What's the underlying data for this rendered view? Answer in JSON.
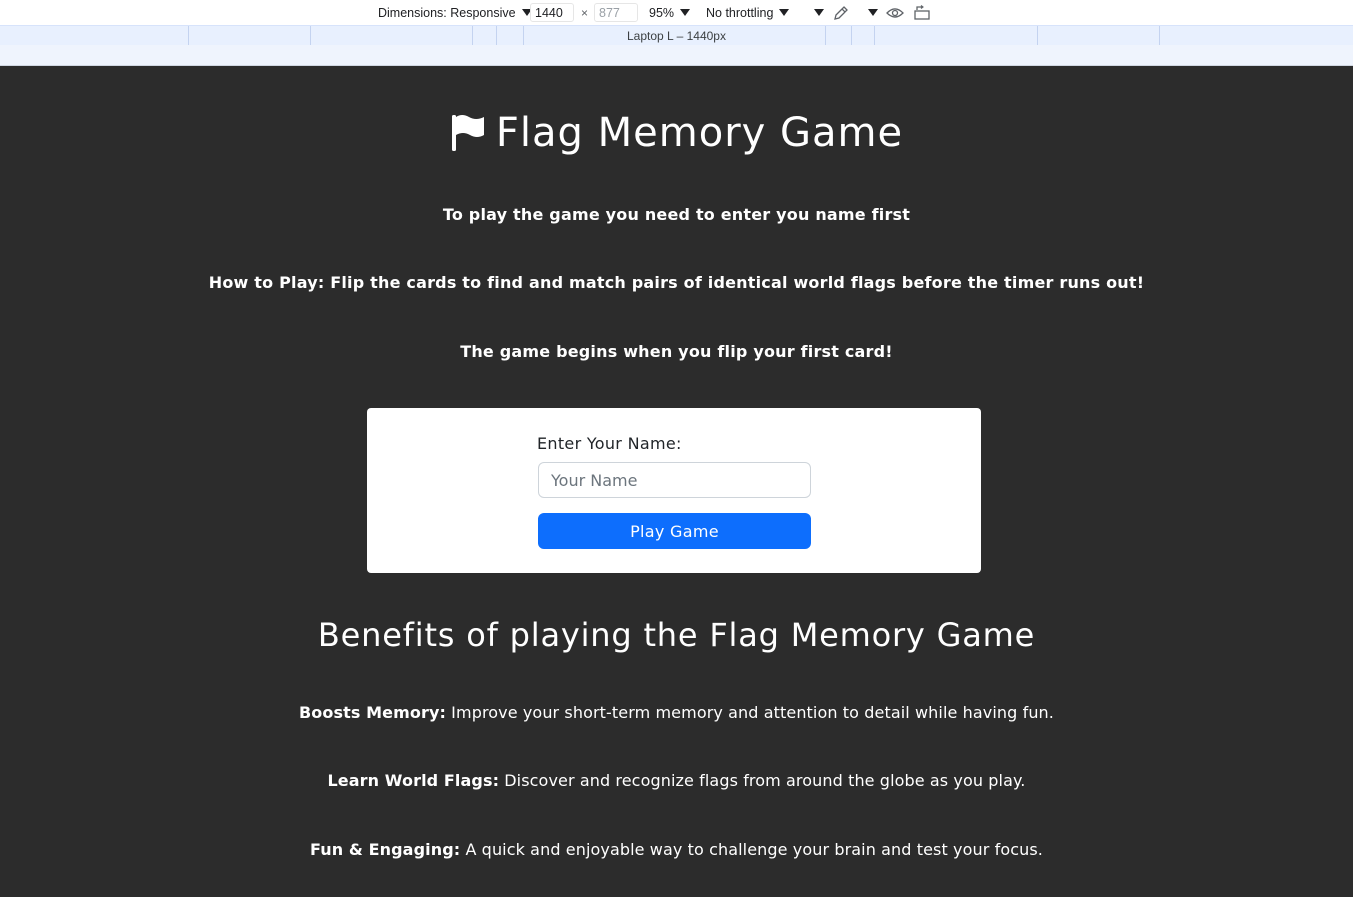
{
  "devtools": {
    "dimensions_label": "Dimensions: Responsive",
    "width_value": "1440",
    "times": "×",
    "height_placeholder": "877",
    "zoom": "95%",
    "throttling": "No throttling",
    "media_label": "Laptop L – 1440px"
  },
  "page": {
    "title": "Flag Memory Game",
    "intro": "To play the game you need to enter you name first",
    "how_to": "How to Play: Flip the cards to find and match pairs of identical world flags before the timer runs out!",
    "begin": "The game begins when you flip your first card!",
    "form": {
      "label": "Enter Your Name:",
      "placeholder": "Your Name",
      "button": "Play Game"
    },
    "benefits_title": "Benefits of playing the Flag Memory Game",
    "benefits": [
      {
        "title": "Boosts Memory:",
        "text": " Improve your short-term memory and attention to detail while having fun."
      },
      {
        "title": "Learn World Flags:",
        "text": " Discover and recognize flags from around the globe as you play."
      },
      {
        "title": "Fun & Engaging:",
        "text": " A quick and enjoyable way to challenge your brain and test your focus."
      }
    ]
  },
  "colors": {
    "background": "#2c2c2c",
    "card": "#ffffff",
    "button": "#0d6efd"
  }
}
